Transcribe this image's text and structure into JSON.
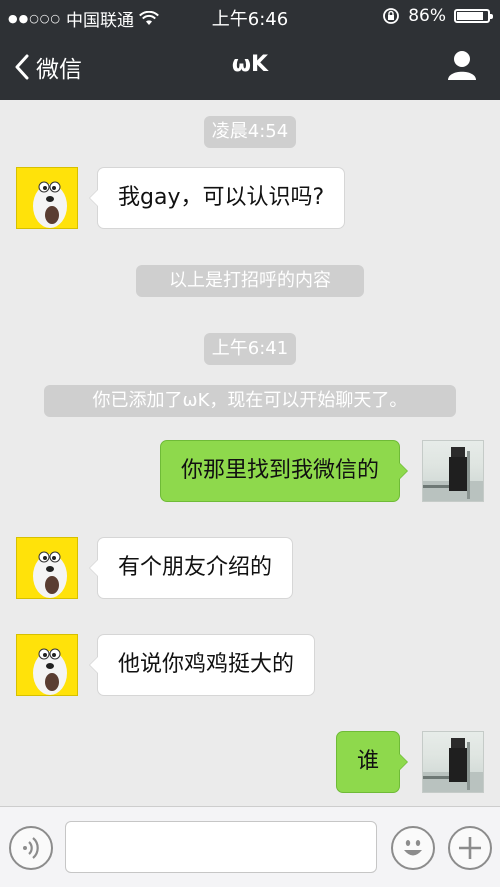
{
  "status_bar": {
    "carrier": "中国联通",
    "time": "上午6:46",
    "battery": "86%",
    "battery_level": 0.86
  },
  "nav": {
    "back_label": "微信",
    "title": "ωK"
  },
  "chat": {
    "timestamps": [
      "凌晨4:54",
      "上午6:41"
    ],
    "system_notices": [
      "以上是打招呼的内容",
      "你已添加了ωK，现在可以开始聊天了。"
    ],
    "messages": [
      {
        "sender": "them",
        "text": "我gay，可以认识吗?"
      },
      {
        "sender": "me",
        "text": "你那里找到我微信的"
      },
      {
        "sender": "them",
        "text": "有个朋友介绍的"
      },
      {
        "sender": "them",
        "text": "他说你鸡鸡挺大的"
      },
      {
        "sender": "me",
        "text": "谁"
      }
    ]
  },
  "input_bar": {
    "value": "",
    "placeholder": "",
    "icons": [
      "voice-icon",
      "emoji-icon",
      "plus-icon"
    ]
  },
  "colors": {
    "nav_bg": "#2e3135",
    "chat_bg": "#ebebeb",
    "outgoing_bubble": "#8ed94c",
    "incoming_bubble": "#ffffff",
    "notice_pill": "#cfcfcf"
  }
}
